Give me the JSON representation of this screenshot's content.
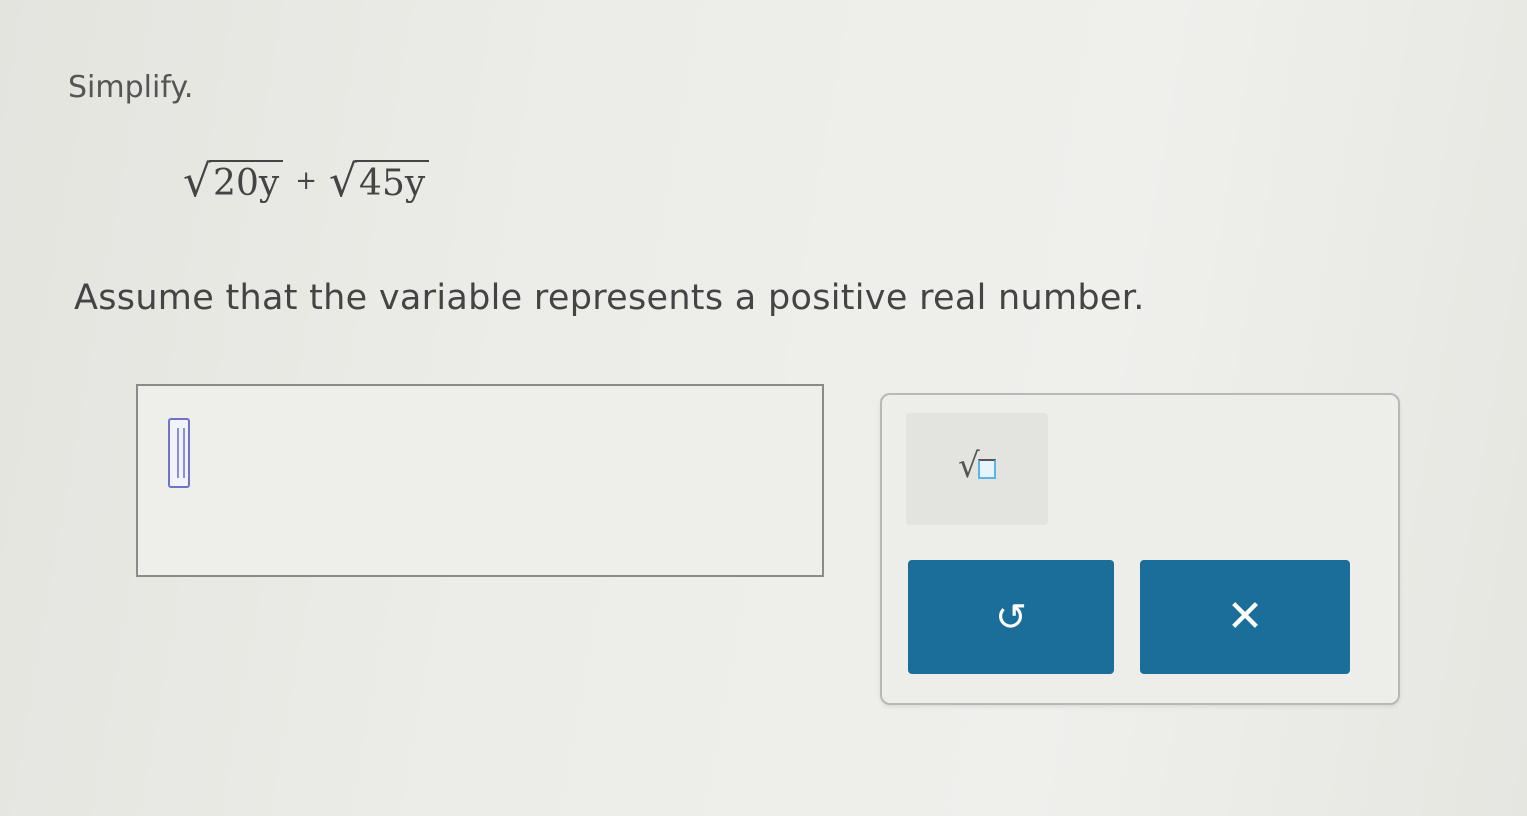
{
  "question": {
    "prompt": "Simplify.",
    "expression": {
      "term1_radicand": "20y",
      "operator": "+",
      "term2_radicand": "45y"
    },
    "assumption": "Assume that the variable represents a positive real number."
  },
  "answer": {
    "value": ""
  },
  "toolbar": {
    "sqrt_tool": "square-root-icon",
    "undo_icon": "undo-icon",
    "clear_icon": "close-icon",
    "undo_glyph": "↺",
    "clear_glyph": "✕",
    "button_color": "#1a6e99"
  }
}
